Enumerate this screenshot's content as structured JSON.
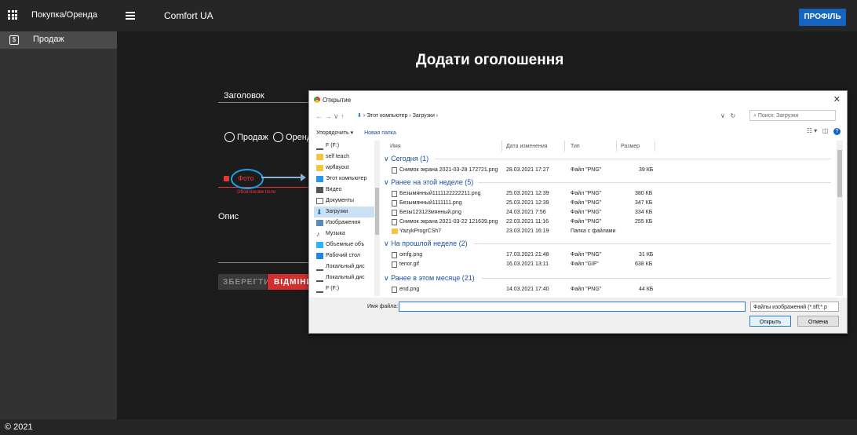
{
  "header": {
    "app_menu_label": "Покупка/Оренда",
    "brand": "Comfort UA",
    "profile_button": "ПРОФІЛЬ"
  },
  "sidebar": {
    "items": [
      {
        "label": "Продаж",
        "icon": "dollar-icon"
      }
    ]
  },
  "form": {
    "title": "Додати оголошення",
    "field_title_label": "Заголовок",
    "radio_sale": "Продаж",
    "radio_rent": "Оренда",
    "photo_label": "Фото",
    "photo_error": "Обов'язкове поле",
    "description_label": "Опис",
    "save_button": "ЗБЕРЕГТИ",
    "cancel_button": "ВІДМІНИТИ"
  },
  "dialog": {
    "title": "Открытие",
    "path": [
      "Этот компьютер",
      "Загрузки"
    ],
    "search_placeholder": "Поиск: Загрузки",
    "organize": "Упорядочить ▾",
    "new_folder": "Новая папка",
    "tree": [
      {
        "label": "F (F:)",
        "icon": "drive-icon"
      },
      {
        "label": "self teach",
        "icon": "folder-icon"
      },
      {
        "label": "wpflayout",
        "icon": "folder-icon"
      },
      {
        "label": "Этот компьютер",
        "icon": "computer-icon"
      },
      {
        "label": "Видео",
        "icon": "video-icon"
      },
      {
        "label": "Документы",
        "icon": "documents-icon"
      },
      {
        "label": "Загрузки",
        "icon": "downloads-icon",
        "selected": true
      },
      {
        "label": "Изображения",
        "icon": "images-icon"
      },
      {
        "label": "Музыка",
        "icon": "music-icon"
      },
      {
        "label": "Объемные объ",
        "icon": "3d-icon"
      },
      {
        "label": "Рабочий стол",
        "icon": "desktop-icon"
      },
      {
        "label": "Локальный дис",
        "icon": "drive-icon"
      },
      {
        "label": "Локальный дис",
        "icon": "drive-icon"
      },
      {
        "label": "F (F:)",
        "icon": "drive-icon"
      }
    ],
    "columns": [
      "Имя",
      "Дата изменения",
      "Тип",
      "Размер"
    ],
    "groups": [
      {
        "label": "Сегодня (1)",
        "rows": [
          {
            "name": "Снимок экрана 2021-03-28 172721.png",
            "date": "28.03.2021 17:27",
            "type": "Файл \"PNG\"",
            "size": "39 КБ"
          }
        ]
      },
      {
        "label": "Ранее на этой неделе (5)",
        "rows": [
          {
            "name": "Безымянный1111122222211.png",
            "date": "25.03.2021 12:39",
            "type": "Файл \"PNG\"",
            "size": "380 КБ"
          },
          {
            "name": "Безымянный1111111.png",
            "date": "25.03.2021 12:39",
            "type": "Файл \"PNG\"",
            "size": "347 КБ"
          },
          {
            "name": "Безы123123мянный.png",
            "date": "24.03.2021 7:56",
            "type": "Файл \"PNG\"",
            "size": "334 КБ"
          },
          {
            "name": "Снимок экрана 2021-03-22 121639.png",
            "date": "22.03.2021 11:16",
            "type": "Файл \"PNG\"",
            "size": "255 КБ"
          },
          {
            "name": "YazykProgrCSh7",
            "date": "23.03.2021 16:19",
            "type": "Папка с файлами",
            "size": ""
          }
        ]
      },
      {
        "label": "На прошлой неделе (2)",
        "rows": [
          {
            "name": "omfg.png",
            "date": "17.03.2021 21:48",
            "type": "Файл \"PNG\"",
            "size": "31 КБ"
          },
          {
            "name": "tenor.gif",
            "date": "16.03.2021 13:11",
            "type": "Файл \"GIF\"",
            "size": "638 КБ"
          }
        ]
      },
      {
        "label": "Ранее в этом месяце (21)",
        "rows": [
          {
            "name": "end.png",
            "date": "14.03.2021 17:40",
            "type": "Файл \"PNG\"",
            "size": "44 КБ"
          }
        ]
      }
    ],
    "filename_label": "Имя файла:",
    "filename_value": "",
    "filetype": "Файлы изображений (*.tiff;*.p",
    "open_button": "Открыть",
    "cancel_button": "Отмена"
  },
  "footer": {
    "copyright": "© 2021"
  },
  "colors": {
    "accent": "#1565c0",
    "danger": "#d32f2f",
    "annotation": "#1ea0e6"
  }
}
